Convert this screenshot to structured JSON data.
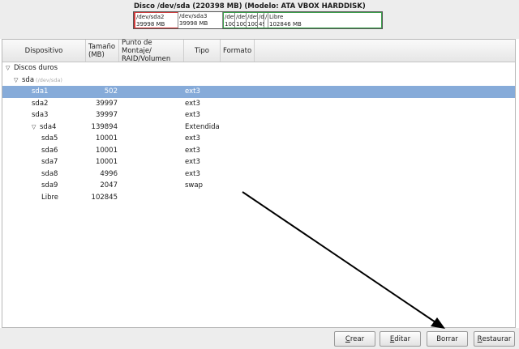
{
  "disk": {
    "title": "Disco /dev/sda (220398 MB) (Modelo: ATA VBOX HARDDISK)",
    "segments": [
      {
        "line1": "/dev/sda2",
        "line2": "39998 MB"
      },
      {
        "line1": "/dev/sda3",
        "line2": "39998 MB"
      },
      {
        "line1": "/dev",
        "line2": "100"
      },
      {
        "line1": "/dev",
        "line2": "100"
      },
      {
        "line1": "/dev",
        "line2": "100"
      },
      {
        "line1": "/d",
        "line2": "49"
      },
      {
        "line1": "/",
        "line2": ""
      },
      {
        "line1": "Libre",
        "line2": "102846 MB"
      }
    ]
  },
  "table": {
    "headers": {
      "device": "Dispositivo",
      "size": "Tamaño (MB)",
      "mount": "Punto de Montaje/ RAID/Volumen",
      "type": "Tipo",
      "format": "Formato"
    },
    "rows": [
      {
        "name": "Discos duros",
        "size": "",
        "type": "",
        "level": 0,
        "expander": "▽"
      },
      {
        "name": "sda",
        "sub": "(/dev/sda)",
        "size": "",
        "type": "",
        "level": 1,
        "expander": "▽"
      },
      {
        "name": "sda1",
        "size": "502",
        "type": "ext3",
        "level": 2,
        "selected": true
      },
      {
        "name": "sda2",
        "size": "39997",
        "type": "ext3",
        "level": 2
      },
      {
        "name": "sda3",
        "size": "39997",
        "type": "ext3",
        "level": 2
      },
      {
        "name": "sda4",
        "size": "139894",
        "type": "Extendida",
        "level": 2,
        "expander": "▽"
      },
      {
        "name": "sda5",
        "size": "10001",
        "type": "ext3",
        "level": 3
      },
      {
        "name": "sda6",
        "size": "10001",
        "type": "ext3",
        "level": 3
      },
      {
        "name": "sda7",
        "size": "10001",
        "type": "ext3",
        "level": 3
      },
      {
        "name": "sda8",
        "size": "4996",
        "type": "ext3",
        "level": 3
      },
      {
        "name": "sda9",
        "size": "2047",
        "type": "swap",
        "level": 3
      },
      {
        "name": "Libre",
        "size": "102845",
        "type": "",
        "level": 3
      }
    ]
  },
  "buttons": {
    "create": {
      "mn": "C",
      "rest": "rear"
    },
    "edit": {
      "mn": "E",
      "rest": "ditar"
    },
    "delete": {
      "mn": "",
      "rest": "Borrar"
    },
    "reset": {
      "mn": "R",
      "rest": "estaurar"
    }
  }
}
